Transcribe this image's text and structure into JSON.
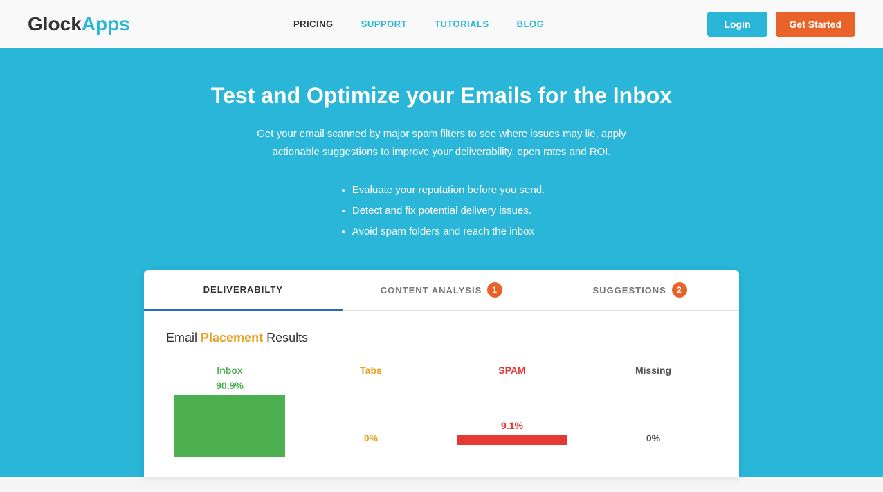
{
  "header": {
    "logo_glock": "Glock",
    "logo_apps": "Apps",
    "nav": [
      {
        "label": "PRICING",
        "active": true
      },
      {
        "label": "SUPPORT",
        "active": false
      },
      {
        "label": "TUTORIALS",
        "active": false
      },
      {
        "label": "BLOG",
        "active": false
      }
    ],
    "btn_login": "Login",
    "btn_get_started": "Get Started"
  },
  "hero": {
    "title": "Test and Optimize your Emails for the Inbox",
    "description": "Get your email scanned by major spam filters to see where issues may lie, apply actionable suggestions to improve your deliverability, open rates and ROI.",
    "bullets": [
      "Evaluate your reputation before you send.",
      "Detect and fix potential delivery issues.",
      "Avoid spam folders and reach the inbox"
    ]
  },
  "panel": {
    "tabs": [
      {
        "label": "DELIVERABILTY",
        "active": true,
        "badge": null
      },
      {
        "label": "CONTENT ANALYSIS",
        "active": false,
        "badge": "1"
      },
      {
        "label": "SUGGESTIONS",
        "active": false,
        "badge": "2"
      }
    ],
    "section_title_plain": "Email ",
    "section_title_highlight": "Placement",
    "section_title_end": " Results",
    "columns": [
      {
        "label": "Inbox",
        "type": "inbox",
        "pct": "90.9%",
        "bar": "inbox"
      },
      {
        "label": "Tabs",
        "type": "tabs-label",
        "pct": "0%",
        "bar": "none"
      },
      {
        "label": "SPAM",
        "type": "spam",
        "pct": "9.1%",
        "bar": "spam"
      },
      {
        "label": "Missing",
        "type": "missing",
        "pct": "0%",
        "bar": "none"
      }
    ]
  }
}
